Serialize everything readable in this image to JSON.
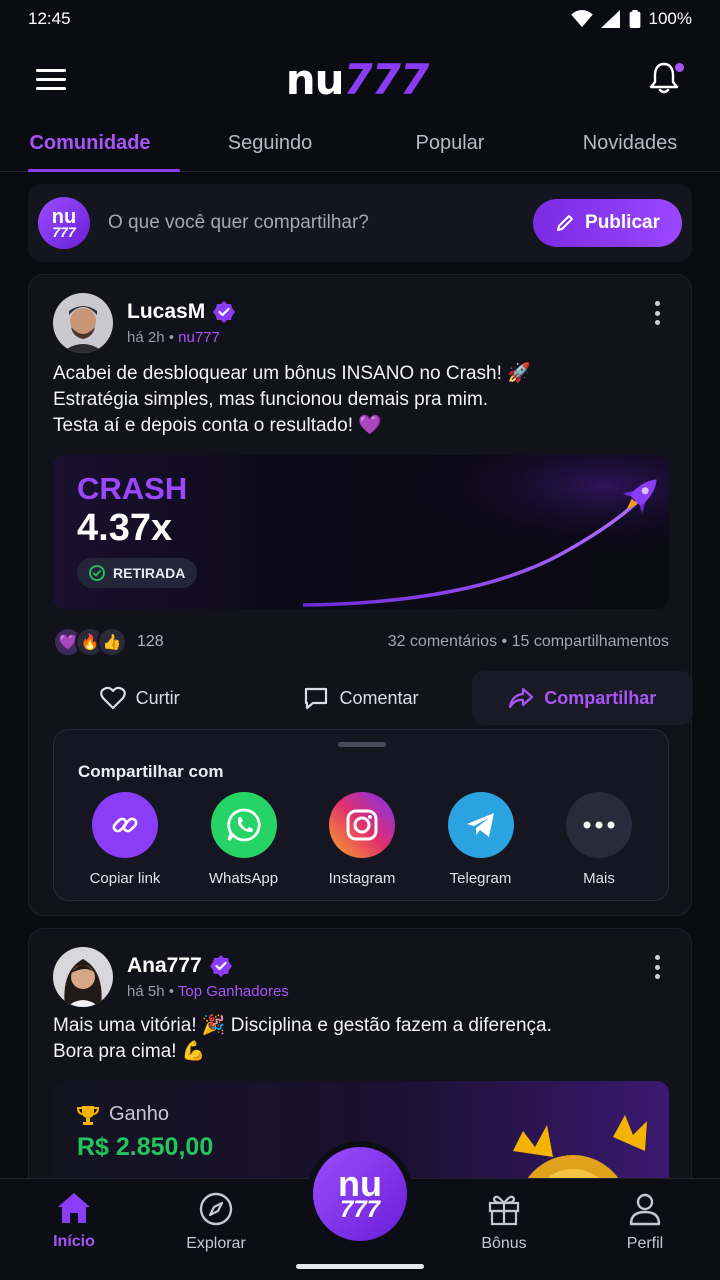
{
  "status": {
    "time": "12:45",
    "battery": "100%"
  },
  "header": {
    "logo_nu": "nu",
    "logo_num": "777"
  },
  "tabs": [
    {
      "label": "Comunidade",
      "active": true
    },
    {
      "label": "Seguindo",
      "active": false
    },
    {
      "label": "Popular",
      "active": false
    },
    {
      "label": "Novidades",
      "active": false
    }
  ],
  "composer": {
    "avatar_top": "nu",
    "avatar_bottom": "777",
    "placeholder": "O que você quer compartilhar?",
    "publish_label": "Publicar"
  },
  "post1": {
    "author": "LucasM",
    "time": "há 2h",
    "tag": "nu777",
    "text": "Acabei de desbloquear um bônus INSANO no Crash! 🚀\nEstratégia simples, mas funcionou demais pra mim.\nTesta aí e depois conta o resultado! 💜",
    "crash_title": "CRASH",
    "crash_multiplier": "4.37x",
    "crash_status": "RETIRADA",
    "reactions_count": "128",
    "comments": "32 comentários",
    "shares": "15 compartilhamentos",
    "actions": {
      "like": "Curtir",
      "comment": "Comentar",
      "share": "Compartilhar"
    },
    "share_sheet": {
      "title": "Compartilhar com",
      "items": [
        {
          "label": "Copiar link",
          "icon": "link-icon",
          "color": "#8b3cf6"
        },
        {
          "label": "WhatsApp",
          "icon": "whatsapp-icon",
          "color": "#25d366"
        },
        {
          "label": "Instagram",
          "icon": "instagram-icon",
          "color": "#e1306c"
        },
        {
          "label": "Telegram",
          "icon": "telegram-icon",
          "color": "#2aa3e0"
        },
        {
          "label": "Mais",
          "icon": "more-icon",
          "color": "#2a2a3a"
        }
      ]
    }
  },
  "post2": {
    "author": "Ana777",
    "time": "há 5h",
    "tag": "Top Ganhadores",
    "text": "Mais uma vitória! 🎉 Disciplina e gestão fazem a diferença.\nBora pra cima! 💪",
    "win_label": "Ganho",
    "win_value": "R$ 2.850,00"
  },
  "bottom_nav": {
    "home": "Início",
    "explore": "Explorar",
    "fab_top": "nu",
    "fab_bottom": "777",
    "bonus": "Bônus",
    "profile": "Perfil"
  },
  "colors": {
    "accent": "#8b3cf6",
    "background": "#0b0b12",
    "card": "#12121b",
    "win_green": "#22c55e"
  }
}
